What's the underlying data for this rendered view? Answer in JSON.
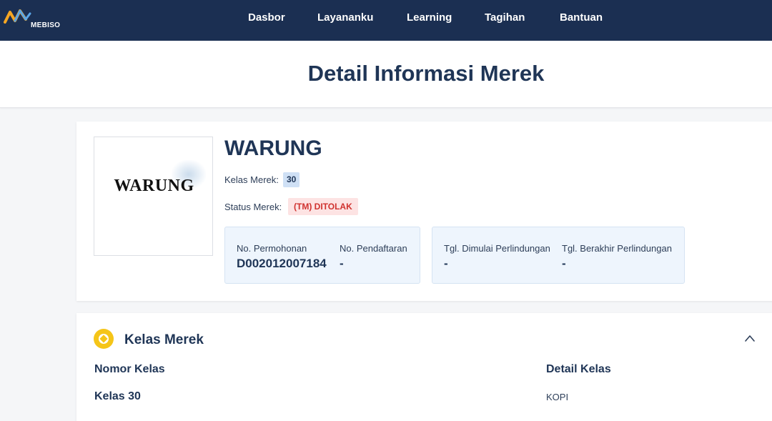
{
  "header": {
    "logo_text": "MEBISO",
    "nav": [
      "Dasbor",
      "Layananku",
      "Learning",
      "Tagihan",
      "Bantuan"
    ]
  },
  "page": {
    "title": "Detail Informasi Merek"
  },
  "brand": {
    "image_text": "WARUNG",
    "name": "WARUNG",
    "kelas_label": "Kelas Merek:",
    "kelas_value": "30",
    "status_label": "Status Merek:",
    "status_value": "(TM) DITOLAK",
    "status_color": "#d0322f"
  },
  "info": {
    "no_permohonan_label": "No. Permohonan",
    "no_permohonan_value": "D002012007184",
    "no_pendaftaran_label": "No. Pendaftaran",
    "no_pendaftaran_value": "-",
    "tgl_mulai_label": "Tgl. Dimulai Perlindungan",
    "tgl_mulai_value": "-",
    "tgl_akhir_label": "Tgl. Berakhir Perlindungan",
    "tgl_akhir_value": "-"
  },
  "kelas_section": {
    "title": "Kelas Merek",
    "icon": "coin-icon",
    "col_nomor": "Nomor Kelas",
    "col_detail": "Detail Kelas",
    "rows": [
      {
        "nomor": "Kelas 30",
        "detail": "KOPI"
      }
    ]
  },
  "colors": {
    "navbar": "#1b2f52",
    "accent_yellow": "#f5c518",
    "text_dark": "#1f3556"
  }
}
